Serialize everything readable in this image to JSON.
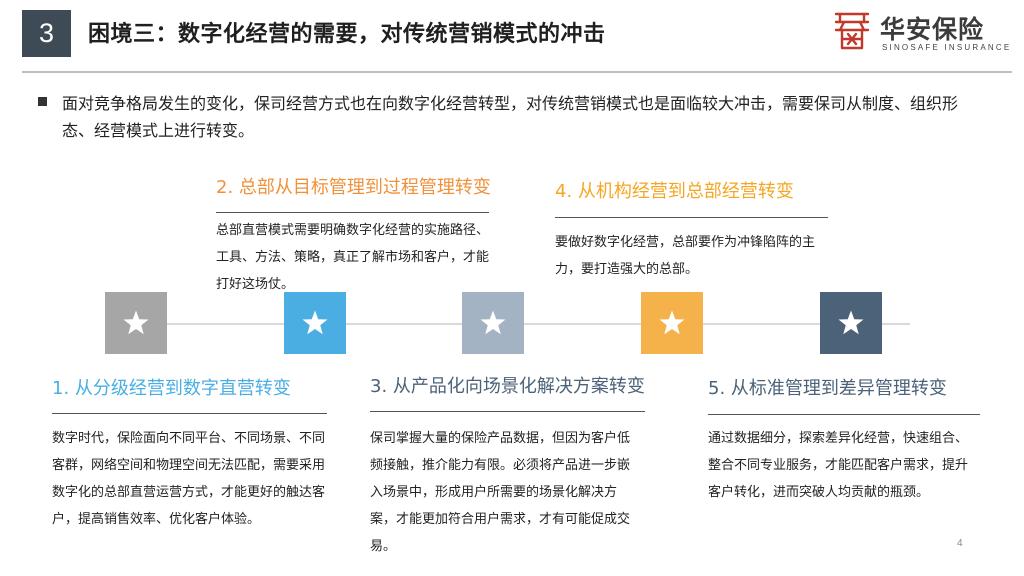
{
  "header": {
    "section_number": "3",
    "title": "困境三：数字化经营的需要，对传统营销模式的冲击",
    "logo_cn": "华安保险",
    "logo_en": "SINOSAFE INSURANCE",
    "logo_mark": "logo-mark",
    "logo_color": "#c0392b"
  },
  "intro": {
    "text": "面对竞争格局发生的变化，保司经营方式也在向数字化经营转型，对传统营销模式也是面临较大冲击，需要保司从制度、组织形态、经营模式上进行转变。"
  },
  "timeline": {
    "stars": [
      {
        "icon": "star-icon",
        "color": "#a6a6a6"
      },
      {
        "icon": "star-icon",
        "color": "#4aaee3"
      },
      {
        "icon": "star-icon",
        "color": "#a3b3c3"
      },
      {
        "icon": "star-icon",
        "color": "#f6b24a"
      },
      {
        "icon": "star-icon",
        "color": "#4b6278"
      }
    ]
  },
  "cards": [
    {
      "title": "1. 从分级经营到数字直营转变",
      "color": "#4aaee3",
      "body": "数字时代，保险面向不同平台、不同场景、不同客群，网络空间和物理空间无法匹配，需要采用数字化的总部直营运营方式，才能更好的触达客户，提高销售效率、优化客户体验。"
    },
    {
      "title": "2. 总部从目标管理到过程管理转变",
      "color": "#f0913a",
      "body": "总部直营模式需要明确数字化经营的实施路径、工具、方法、策略，真正了解市场和客户，才能打好这场仗。"
    },
    {
      "title": "3. 从产品化向场景化解决方案转变",
      "color": "#4b6278",
      "body": "保司掌握大量的保险产品数据，但因为客户低频接触，推介能力有限。必须将产品进一步嵌入场景中，形成用户所需要的场景化解决方案，才能更加符合用户需求，才有可能促成交易。"
    },
    {
      "title": "4. 从机构经营到总部经营转变",
      "color": "#f6a623",
      "body": "要做好数字化经营，总部要作为冲锋陷阵的主力，要打造强大的总部。"
    },
    {
      "title": "5. 从标准管理到差异管理转变",
      "color": "#4b6278",
      "body": "通过数据细分，探索差异化经营，快速组合、整合不同专业服务，才能匹配客户需求，提升客户转化，进而突破人均贡献的瓶颈。"
    }
  ],
  "footer": {
    "page_number": "4"
  }
}
